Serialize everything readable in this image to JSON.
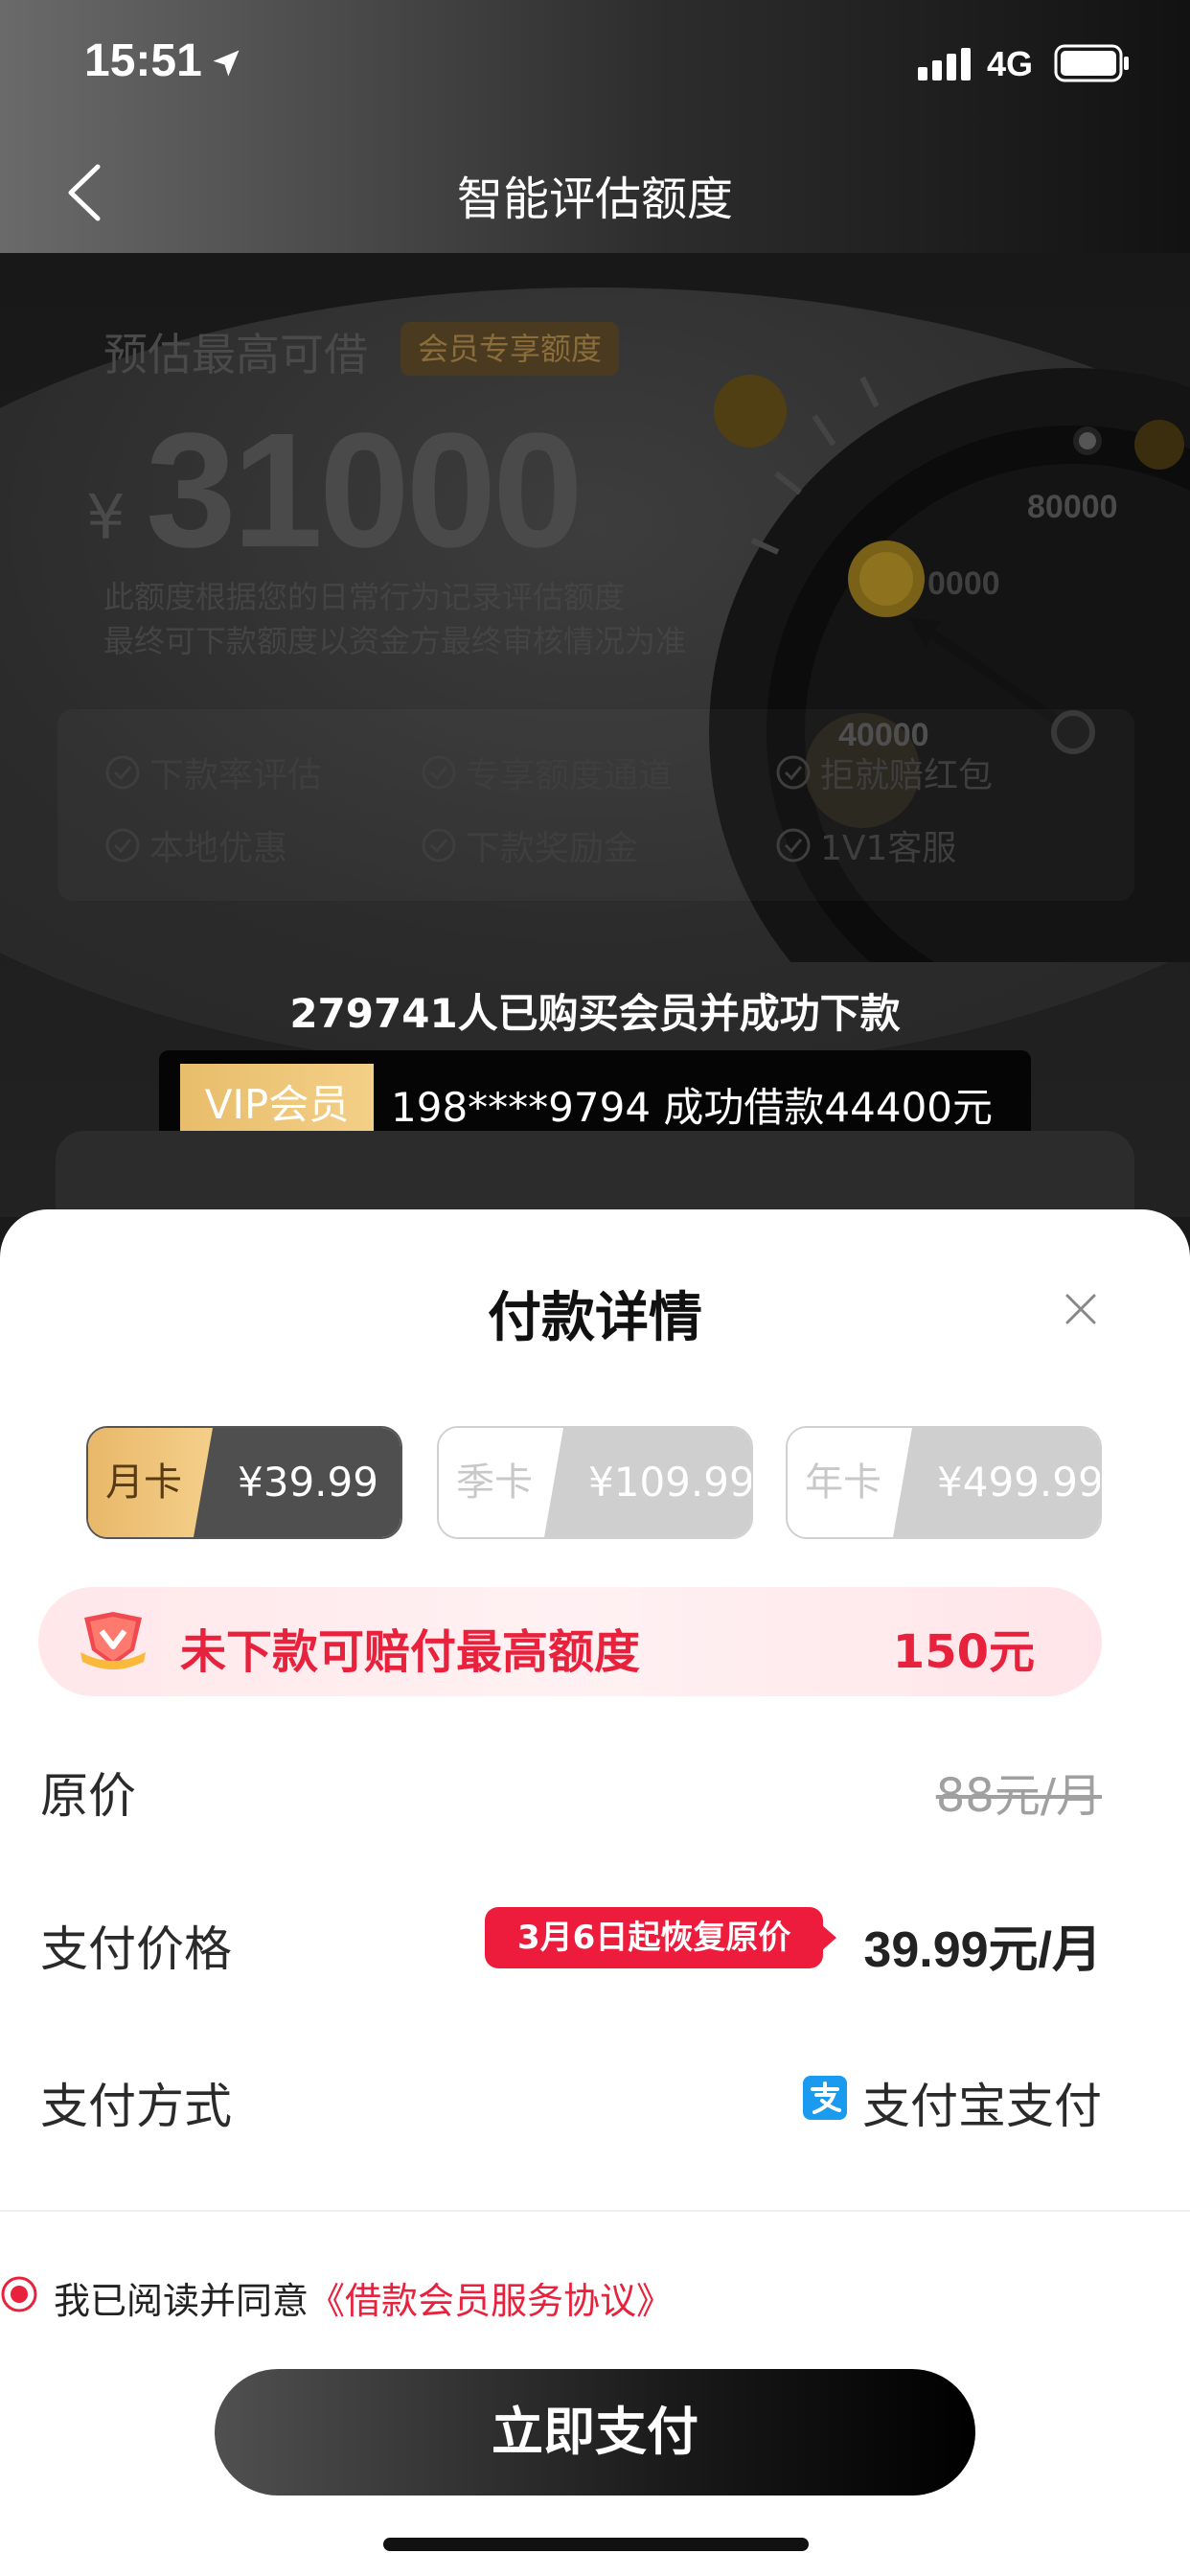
{
  "status_bar": {
    "time": "15:51",
    "network": "4G"
  },
  "nav": {
    "title": "智能评估额度"
  },
  "hero": {
    "label": "预估最高可借",
    "member_tag": "会员专享额度",
    "currency": "¥",
    "amount": "31000",
    "note_line1": "此额度根据您的日常行为记录评估额度",
    "note_line2": "最终可下款额度以资金方最终审核情况为准",
    "gauge_labels": [
      "80000",
      "0000",
      "40000"
    ],
    "benefits": [
      "下款率评估",
      "专享额度通道",
      "拒就赔红包",
      "本地优惠",
      "下款奖励金",
      "1V1客服"
    ]
  },
  "social_proof": {
    "buyers": "279741人已购买会员并成功下款",
    "ticker_badge": "VIP会员",
    "ticker_text": "198****9794 成功借款44400元"
  },
  "sheet": {
    "title": "付款详情",
    "plans": [
      {
        "name": "月卡",
        "price": "¥39.99",
        "selected": true
      },
      {
        "name": "季卡",
        "price": "¥109.99",
        "selected": false
      },
      {
        "name": "年卡",
        "price": "¥499.99",
        "selected": false
      }
    ],
    "compensation": {
      "text": "未下款可赔付最高额度",
      "amount": "150元"
    },
    "original_price": {
      "label": "原价",
      "value": "88元/月"
    },
    "pay_price": {
      "label": "支付价格",
      "tag": "3月6日起恢复原价",
      "value": "39.99元/月"
    },
    "pay_method": {
      "label": "支付方式",
      "value": "支付宝支付"
    },
    "agreement": {
      "prefix": "我已阅读并同意",
      "link": "《借款会员服务协议》"
    },
    "pay_button": "立即支付"
  },
  "colors": {
    "accent_red": "#e8213c",
    "gold": "#e9b869",
    "dark": "#1a1a1a"
  }
}
